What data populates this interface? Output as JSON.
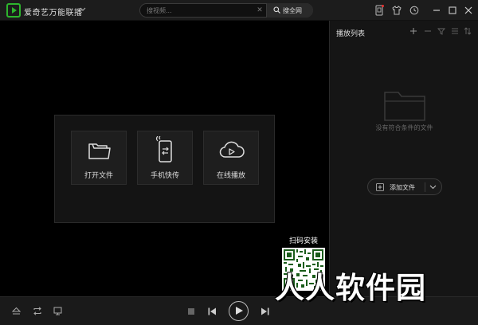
{
  "app": {
    "title": "爱奇艺万能联播",
    "brand_color": "#2db52d"
  },
  "search": {
    "placeholder": "搜视频...",
    "button_label": "搜全网"
  },
  "titlebar_icons": [
    "phone-icon",
    "shirt-icon",
    "clock-icon",
    "minimize-icon",
    "maximize-icon",
    "close-icon"
  ],
  "center": {
    "buttons": [
      {
        "label": "打开文件",
        "icon": "folder-icon"
      },
      {
        "label": "手机快传",
        "icon": "phone-transfer-icon"
      },
      {
        "label": "在线播放",
        "icon": "cloud-play-icon"
      }
    ]
  },
  "playlist": {
    "title": "播放列表",
    "header_icons": [
      "add-icon",
      "remove-icon",
      "filter-icon",
      "list-icon",
      "sort-icon"
    ],
    "empty_text": "没有符合条件的文件",
    "add_button_label": "添加文件"
  },
  "qr": {
    "label": "扫码安装"
  },
  "controls": {
    "left_icons": [
      "eject-icon",
      "repeat-icon",
      "screen-icon"
    ],
    "center_icons": [
      "stop-icon",
      "prev-icon",
      "play-icon",
      "next-icon"
    ]
  },
  "watermark": {
    "text": "人人软件园"
  }
}
